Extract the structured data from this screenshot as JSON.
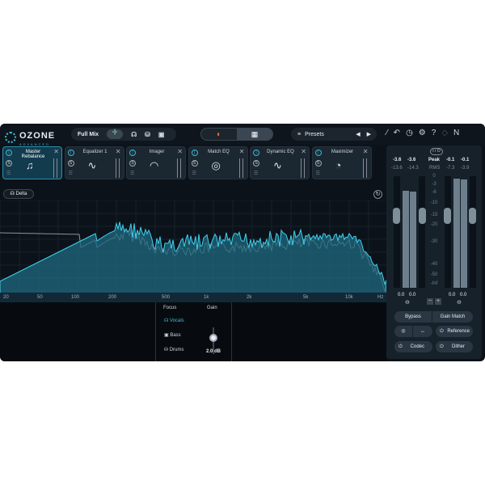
{
  "header": {
    "logo": "OZONE",
    "logo_sub": "ADVANCED",
    "mix_label": "Full Mix",
    "presets_label": "Presets"
  },
  "modules": [
    {
      "name": "Master Rebalance",
      "icon": "♫"
    },
    {
      "name": "Equalizer 1",
      "icon": "∿"
    },
    {
      "name": "Imager",
      "icon": "◠"
    },
    {
      "name": "Match EQ",
      "icon": "◎"
    },
    {
      "name": "Dynamic EQ",
      "icon": "∿"
    },
    {
      "name": "Maximizer",
      "icon": "◔"
    }
  ],
  "delta_label": "Delta",
  "freq_labels": [
    "20",
    "50",
    "100",
    "200",
    "500",
    "1k",
    "2k",
    "5k",
    "10k",
    "Hz"
  ],
  "focus": {
    "title": "Focus",
    "gain_title": "Gain",
    "items": [
      "Vocals",
      "Bass",
      "Drums"
    ],
    "gain_value": "2.0 dB",
    "gain_level": 0.6
  },
  "meters": {
    "io": "I / O",
    "peak": "Peak",
    "rms": "RMS",
    "in_peak": [
      "-3.6",
      "-3.6"
    ],
    "out_peak": [
      "-0.1",
      "-0.1"
    ],
    "in_rms": [
      "-13.6",
      "-14.3"
    ],
    "out_rms": [
      "-7.3",
      "-3.9"
    ],
    "scale": [
      "0",
      "-3",
      "-6",
      "-10",
      "-15",
      "-20",
      "-30",
      "-40",
      "-50",
      "-Inf"
    ],
    "in_gain": [
      "0.0",
      "0.0"
    ],
    "out_gain": [
      "0.0",
      "0.0"
    ],
    "bypass": "Bypass",
    "gain_match": "Gain Match",
    "reference": "Reference",
    "codec": "Codec",
    "dither": "Dither"
  },
  "colors": {
    "accent": "#3fb9d4",
    "bg": "#0c1219"
  }
}
